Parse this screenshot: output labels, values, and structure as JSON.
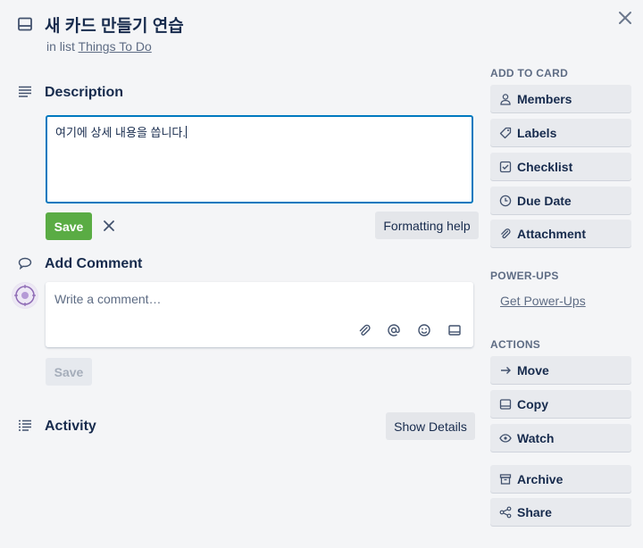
{
  "card": {
    "title": "새 카드 만들기 연습",
    "in_list_prefix": "in list",
    "list_name": "Things To Do"
  },
  "description": {
    "heading": "Description",
    "text": "여기에 상세 내용을 씁니다.",
    "save_label": "Save",
    "formatting_help_label": "Formatting help"
  },
  "comment": {
    "heading": "Add Comment",
    "placeholder": "Write a comment…",
    "save_label": "Save",
    "tools": [
      "attachment-icon",
      "mention-icon",
      "emoji-icon",
      "card-icon"
    ]
  },
  "activity": {
    "heading": "Activity",
    "show_details_label": "Show Details"
  },
  "sidebar": {
    "add_to_card_heading": "ADD TO CARD",
    "add_to_card": [
      {
        "label": "Members",
        "icon": "person-icon"
      },
      {
        "label": "Labels",
        "icon": "tag-icon"
      },
      {
        "label": "Checklist",
        "icon": "checkbox-icon"
      },
      {
        "label": "Due Date",
        "icon": "clock-icon"
      },
      {
        "label": "Attachment",
        "icon": "paperclip-icon"
      }
    ],
    "power_ups_heading": "POWER-UPS",
    "get_power_ups_label": "Get Power-Ups",
    "actions_heading": "ACTIONS",
    "actions": [
      {
        "label": "Move",
        "icon": "arrow-right-icon"
      },
      {
        "label": "Copy",
        "icon": "card-icon"
      },
      {
        "label": "Watch",
        "icon": "eye-icon"
      },
      {
        "label": "Archive",
        "icon": "archive-icon"
      },
      {
        "label": "Share",
        "icon": "share-icon"
      }
    ]
  },
  "colors": {
    "accent_blue": "#0079bf",
    "save_green": "#5aac44",
    "background": "#f4f5f7",
    "text_dark": "#172b4d",
    "text_muted": "#5e6c84"
  }
}
